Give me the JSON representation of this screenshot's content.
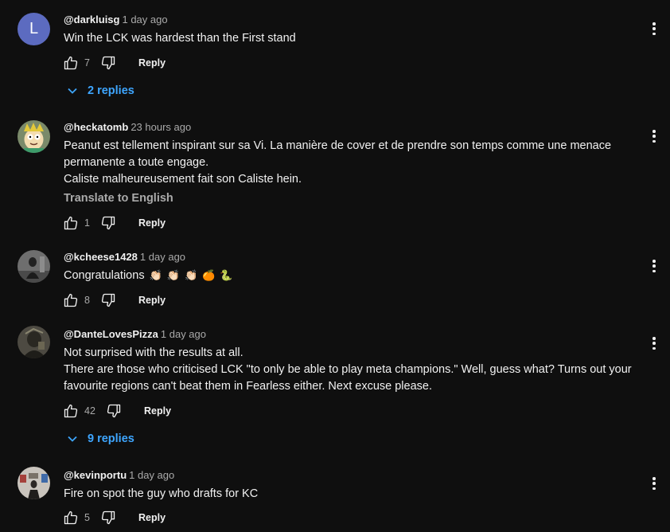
{
  "comments": [
    {
      "author": "@darkluisg",
      "time": "1 day ago",
      "avatar_letter": "L",
      "lines": [
        "Win the LCK was hardest than the First stand"
      ],
      "likes": "7",
      "reply_label": "Reply",
      "replies_label": "2 replies"
    },
    {
      "author": "@heckatomb",
      "time": "23 hours ago",
      "lines": [
        "Peanut est tellement inspirant sur sa Vi. La manière de cover et de prendre son temps comme une menace",
        "permanente a toute engage.",
        "Caliste malheureusement fait son Caliste hein."
      ],
      "translate_label": "Translate to English",
      "likes": "1",
      "reply_label": "Reply"
    },
    {
      "author": "@kcheese1428",
      "time": "1 day ago",
      "lines": [
        "Congratulations"
      ],
      "emojis": [
        "👏🏻",
        "👏🏻",
        "👏🏻",
        "🍊",
        "🐍"
      ],
      "likes": "8",
      "reply_label": "Reply"
    },
    {
      "author": "@DanteLovesPizza",
      "time": "1 day ago",
      "lines": [
        "Not surprised with the results at all.",
        "There are those who criticised LCK \"to only be able to play meta champions.\" Well, guess what? Turns out your",
        "favourite regions can't beat them in Fearless either. Next excuse please."
      ],
      "likes": "42",
      "reply_label": "Reply",
      "replies_label": "9 replies"
    },
    {
      "author": "@kevinportu",
      "time": "1 day ago",
      "lines": [
        "Fire on spot the guy who drafts for KC"
      ],
      "likes": "5",
      "reply_label": "Reply"
    }
  ],
  "colors": {
    "background": "#0f0f0f",
    "text": "#f1f1f1",
    "muted": "#aaaaaa",
    "link": "#3ea6ff",
    "letter_avatar": "#5c6bc0"
  }
}
